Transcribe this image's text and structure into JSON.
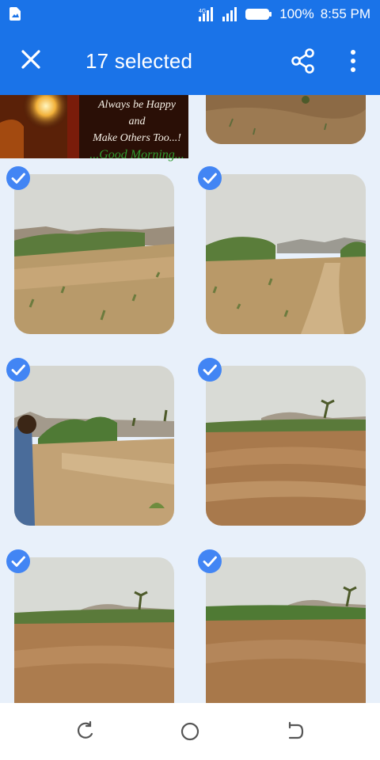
{
  "status_bar": {
    "battery_percent": "100%",
    "time": "8:55 PM",
    "icons": [
      "gallery-notification-icon",
      "signal-icon",
      "signal-icon",
      "battery-icon"
    ]
  },
  "app_bar": {
    "title": "17 selected",
    "icons": [
      "close-icon",
      "share-icon",
      "more-vert-icon"
    ]
  },
  "top_photo": {
    "lines": [
      "Always be Happy",
      "and",
      "Make Others Too...!",
      "...Good Morning..."
    ]
  },
  "photos": [
    {
      "selected": true,
      "description_icon": "landscape-photo"
    },
    {
      "selected": true,
      "description_icon": "landscape-photo"
    },
    {
      "selected": true,
      "description_icon": "landscape-photo-person"
    },
    {
      "selected": true,
      "description_icon": "landscape-photo"
    },
    {
      "selected": true,
      "description_icon": "landscape-photo"
    },
    {
      "selected": true,
      "description_icon": "landscape-photo"
    }
  ],
  "nav_bar": {
    "icons": [
      "recent-apps-icon",
      "home-icon",
      "back-icon"
    ]
  },
  "colors": {
    "accent": "#1a73e8",
    "grid_background": "#e8f0fa",
    "check": "#4285f4"
  }
}
